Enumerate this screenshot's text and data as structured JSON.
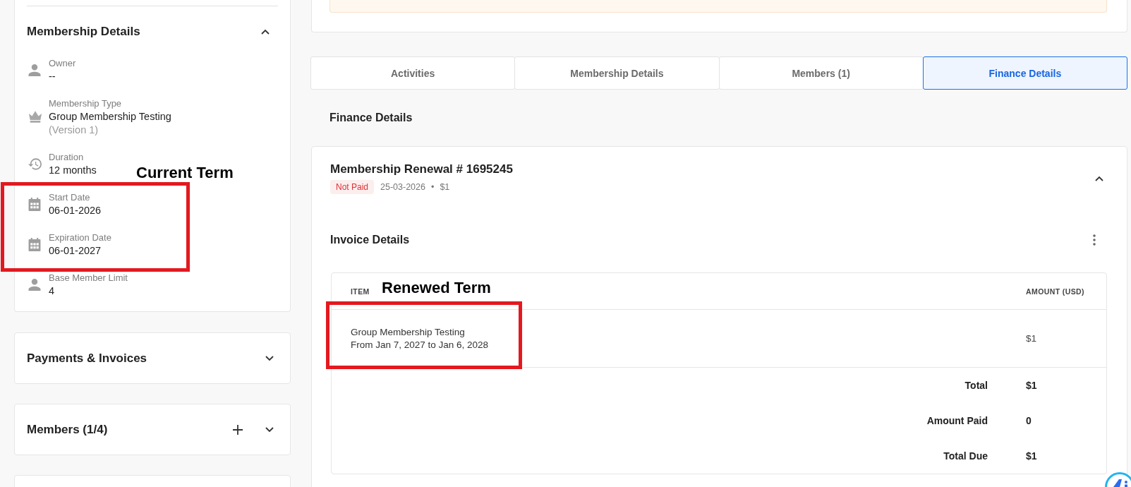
{
  "sidebar": {
    "membership_details": {
      "title": "Membership Details",
      "expanded": true,
      "fields": [
        {
          "kind": "person",
          "label": "Owner",
          "value": "--"
        },
        {
          "kind": "crown",
          "label": "Membership Type",
          "value": "Group Membership Testing",
          "note": "(Version 1)"
        },
        {
          "kind": "history",
          "label": "Duration",
          "value": "12 months"
        },
        {
          "kind": "calendar",
          "label": "Start Date",
          "value": "06-01-2026"
        },
        {
          "kind": "calendar",
          "label": "Expiration Date",
          "value": "06-01-2027"
        },
        {
          "kind": "person",
          "label": "Base Member Limit",
          "value": "4"
        }
      ]
    },
    "sections": [
      {
        "title": "Payments & Invoices",
        "expanded": false,
        "can_add": false
      },
      {
        "title": "Members (1/4)",
        "expanded": false,
        "can_add": true
      }
    ]
  },
  "tabs": [
    {
      "label": "Activities",
      "selected": false
    },
    {
      "label": "Membership Details",
      "selected": false
    },
    {
      "label": "Members (1)",
      "selected": false
    },
    {
      "label": "Finance Details",
      "selected": true
    }
  ],
  "finance": {
    "heading": "Finance Details",
    "renewal": {
      "title": "Membership Renewal # 1695245",
      "expanded": true,
      "status": {
        "text": "Not Paid",
        "kind": "unpaid"
      },
      "date": "25-03-2026",
      "separator": "•",
      "amount": "$1"
    },
    "invoice": {
      "title": "Invoice Details",
      "columns": [
        "ITEM",
        "AMOUNT (USD)"
      ],
      "rows": [
        {
          "item": "Group Membership Testing",
          "period": "From Jan 7, 2027 to Jan 6, 2028",
          "amount": "$1"
        }
      ],
      "totals": [
        {
          "label": "Total",
          "value": "$1"
        },
        {
          "label": "Amount Paid",
          "value": "0"
        },
        {
          "label": "Total Due",
          "value": "$1"
        }
      ]
    }
  },
  "annotations": [
    {
      "text": "Current Term"
    },
    {
      "text": "Renewed Term"
    }
  ]
}
